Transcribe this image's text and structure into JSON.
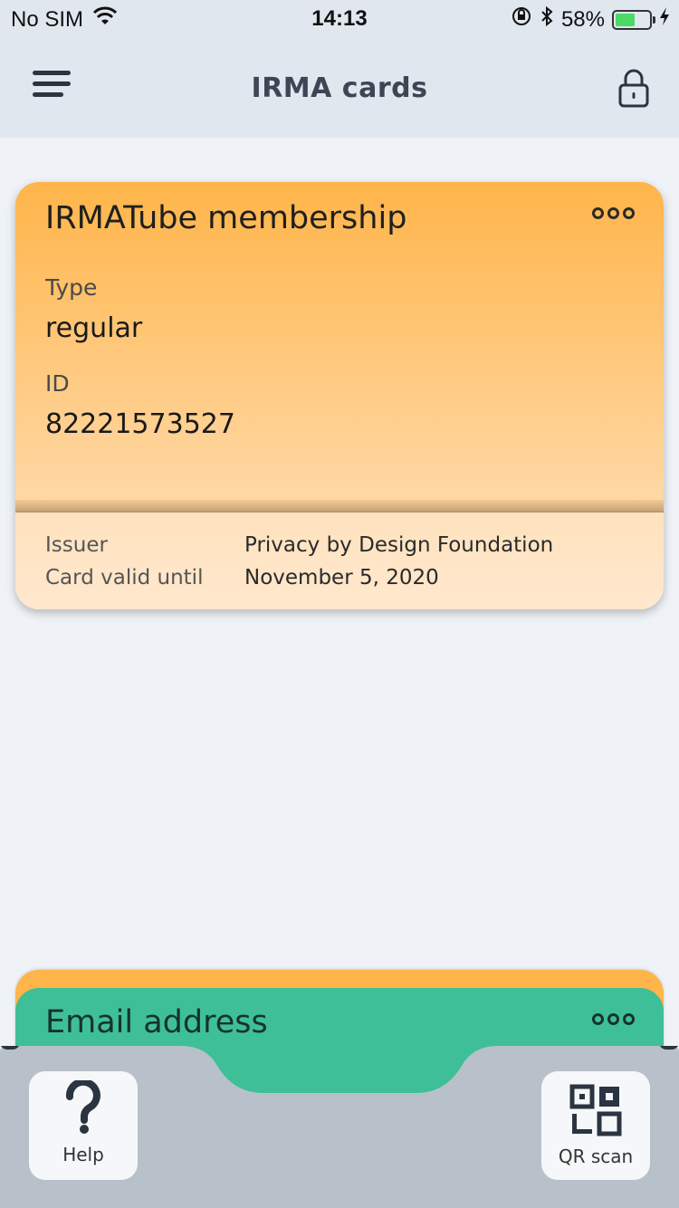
{
  "status_bar": {
    "carrier": "No SIM",
    "time": "14:13",
    "battery_percent": "58%",
    "battery_level": 0.58,
    "icons": [
      "wifi-icon",
      "orientation-lock-icon",
      "bluetooth-icon",
      "battery-icon",
      "charging-icon"
    ]
  },
  "header": {
    "title": "IRMA cards",
    "menu_icon": "hamburger-menu-icon",
    "lock_icon": "padlock-icon"
  },
  "card": {
    "title": "IRMATube membership",
    "more_icon": "more-options-icon",
    "attributes": [
      {
        "label": "Type",
        "value": "regular"
      },
      {
        "label": "ID",
        "value": "82221573527"
      }
    ],
    "issuer_label": "Issuer",
    "issuer_value": "Privacy by Design Foundation",
    "valid_label": "Card valid until",
    "valid_value": "November 5, 2020",
    "colors": {
      "top": "#ffb54a",
      "bottom": "#ffe2bd"
    }
  },
  "stack": {
    "email_title": "Email address",
    "email_color": "#3ebf97",
    "orange_color": "#ffb54a"
  },
  "toolbar": {
    "help_label": "Help",
    "help_icon": "question-mark-icon",
    "qr_label": "QR scan",
    "qr_icon": "qr-code-icon"
  }
}
